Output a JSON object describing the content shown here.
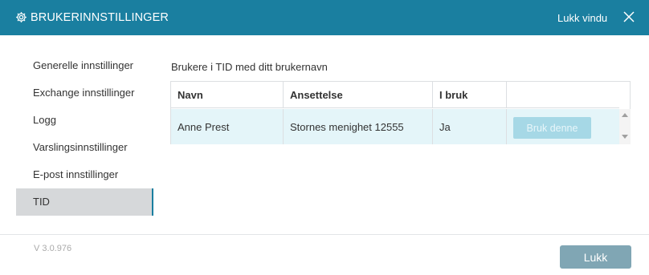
{
  "window": {
    "title": "BRUKERINNSTILLINGER",
    "close_label": "Lukk vindu"
  },
  "sidebar": {
    "items": [
      {
        "label": "Generelle innstillinger"
      },
      {
        "label": "Exchange innstillinger"
      },
      {
        "label": "Logg"
      },
      {
        "label": "Varslingsinnstillinger"
      },
      {
        "label": "E-post innstillinger"
      },
      {
        "label": "TID",
        "active": true
      }
    ]
  },
  "main": {
    "heading": "Brukere i TID med ditt brukernavn",
    "table": {
      "columns": [
        "Navn",
        "Ansettelse",
        "I bruk",
        ""
      ],
      "rows": [
        {
          "navn": "Anne Prest",
          "ansettelse": "Stornes menighet 12555",
          "i_bruk": "Ja",
          "action": "Bruk denne"
        }
      ]
    }
  },
  "footer": {
    "version": "V 3.0.976",
    "close_button": "Lukk"
  },
  "colors": {
    "header": "#1a7fa0",
    "selected_row": "#e4f5f9",
    "disabled_button": "#a6d8e6",
    "close_button": "#80a6b4"
  }
}
